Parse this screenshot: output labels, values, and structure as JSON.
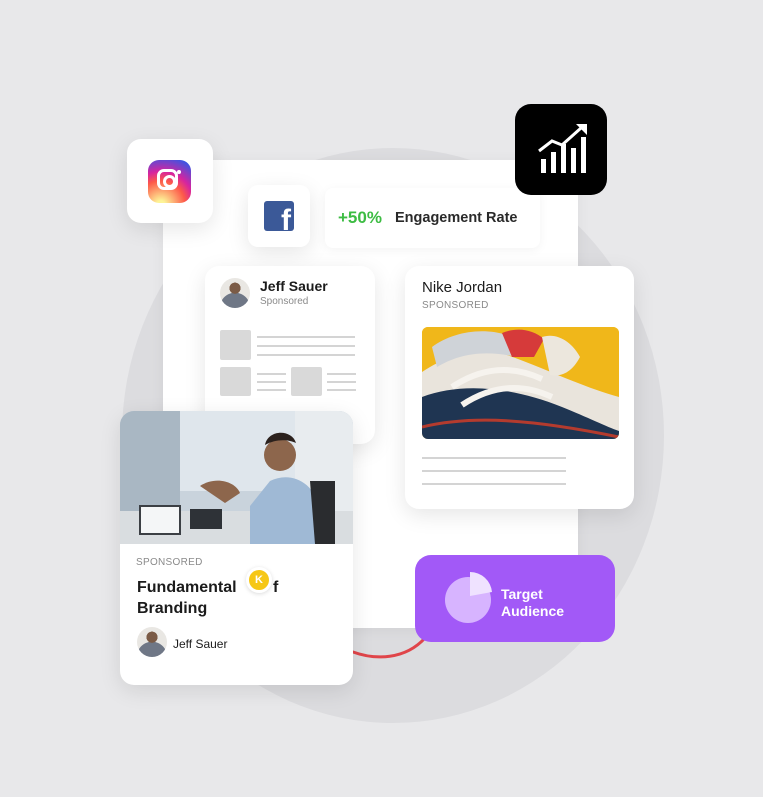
{
  "engagement": {
    "value": "+50%",
    "label": "Engagement Rate"
  },
  "jeff_post": {
    "author": "Jeff Sauer",
    "tag": "Sponsored"
  },
  "nike_post": {
    "title": "Nike Jordan",
    "tag": "SPONSORED"
  },
  "branding_post": {
    "tag": "SPONSORED",
    "title_line1": "Fundamental",
    "title_line2_suffix": "f",
    "title_line2": "Branding",
    "author": "Jeff Sauer"
  },
  "badge": {
    "letter": "K"
  },
  "target": {
    "line1": "Target",
    "line2": "Audience"
  },
  "colors": {
    "engagement_green": "#3dbc43",
    "target_purple": "#a259f7",
    "connector_red": "#e0454a",
    "facebook_blue": "#3b5998",
    "badge_yellow": "#f6c716"
  },
  "icons": {
    "instagram": "instagram-logo-icon",
    "facebook": "facebook-logo-icon",
    "analytics": "growth-chart-icon",
    "pie": "pie-chart-icon"
  }
}
